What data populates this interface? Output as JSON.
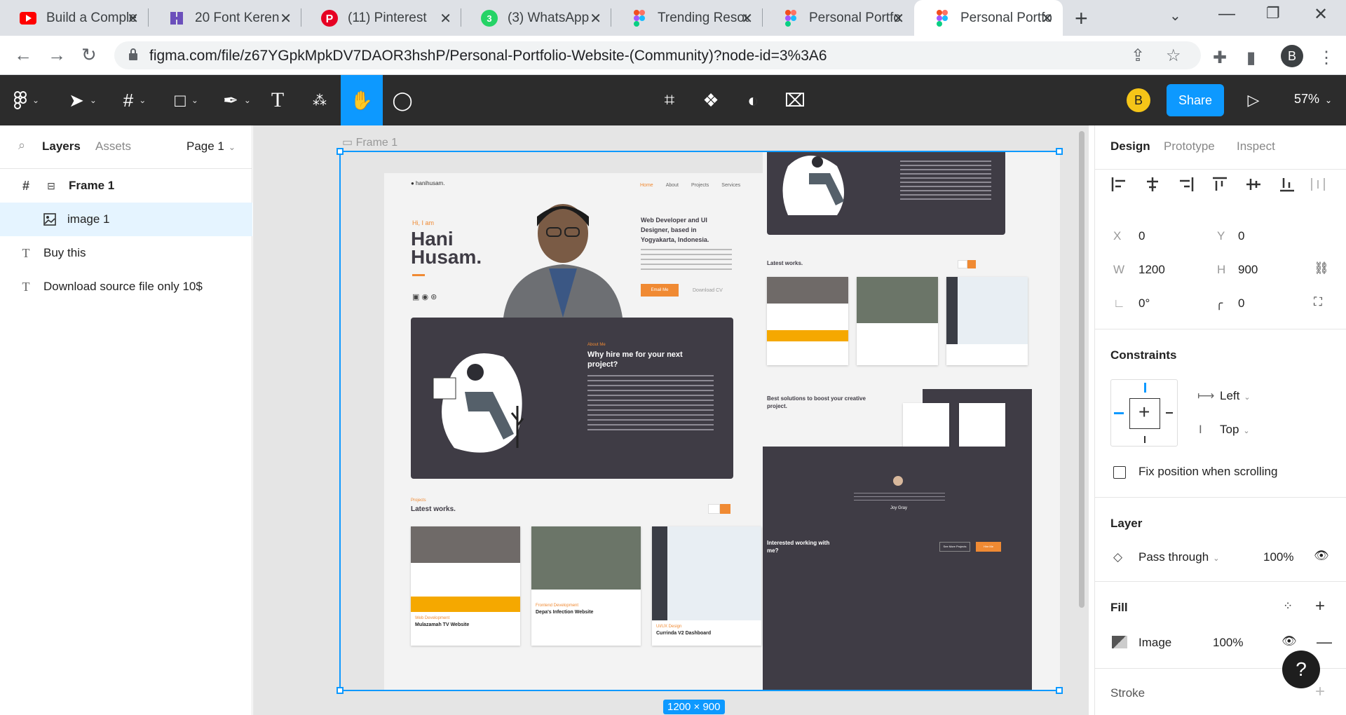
{
  "browser": {
    "tabs": [
      {
        "title": "Build a Comple",
        "icon": "youtube-icon",
        "color": "#ff0000"
      },
      {
        "title": "20 Font Keren",
        "icon": "bookmark-icon",
        "color": "#6b4fbb"
      },
      {
        "title": "(11) Pinterest",
        "icon": "pinterest-icon",
        "color": "#e60023"
      },
      {
        "title": "(3) WhatsApp",
        "icon": "whatsapp-icon",
        "color": "#25d366"
      },
      {
        "title": "Trending Resou",
        "icon": "figma-icon",
        "color": "#f24e1e"
      },
      {
        "title": "Personal Portfo",
        "icon": "figma-icon",
        "color": "#f24e1e"
      },
      {
        "title": "Personal Portfo",
        "icon": "figma-icon",
        "color": "#f24e1e",
        "active": true
      }
    ],
    "url": "figma.com/file/z67YGpkMpkDV7DAOR3hshP/Personal-Portfolio-Website-(Community)?node-id=3%3A6",
    "profile_initial": "B"
  },
  "toolbar": {
    "user_initial": "B",
    "share_label": "Share",
    "zoom": "57%"
  },
  "left_panel": {
    "tab_layers": "Layers",
    "tab_assets": "Assets",
    "page": "Page 1",
    "layers": [
      {
        "name": "Frame 1",
        "type": "frame",
        "bold": true
      },
      {
        "name": "image 1",
        "type": "image",
        "selected": true
      },
      {
        "name": "Buy this",
        "type": "text"
      },
      {
        "name": "Download source file only 10$",
        "type": "text"
      }
    ]
  },
  "canvas": {
    "frame_label": "Frame 1",
    "dimensions": "1200 × 900",
    "design": {
      "greeting": "Hi, I am",
      "name_line1": "Hani",
      "name_line2": "Husam.",
      "nav": [
        "Home",
        "About",
        "Projects",
        "Services"
      ],
      "tagline": "Web Developer and UI Designer, based in Yogyakarta, Indonesia.",
      "email_btn": "Email Me",
      "download_cv": "Download CV",
      "about_heading": "Why hire me for your next project?",
      "about_label": "About Me",
      "projects_label": "Projects",
      "latest_works": "Latest works.",
      "project_titles": [
        "Mulazamah TV Website",
        "Depa's Infection Website",
        "Currinda V2 Dashboard"
      ],
      "project_cats": [
        "Web Development",
        "Frontend Development",
        "UI/UX Design"
      ],
      "services_heading": "Best solutions to boost your creative project.",
      "testimonial_name": "Joy Gray",
      "cta_heading": "Interested working with me?",
      "see_more": "See More Projects",
      "hire_me": "Hire Me"
    }
  },
  "right_panel": {
    "tabs": [
      "Design",
      "Prototype",
      "Inspect"
    ],
    "x": "0",
    "y": "0",
    "w": "1200",
    "h": "900",
    "rotation": "0°",
    "radius": "0",
    "constraints_title": "Constraints",
    "constraint_h": "Left",
    "constraint_v": "Top",
    "fix_position": "Fix position when scrolling",
    "layer_title": "Layer",
    "blend": "Pass through",
    "opacity": "100%",
    "fill_title": "Fill",
    "fill_type": "Image",
    "fill_opacity": "100%",
    "stroke_title": "Stroke"
  }
}
